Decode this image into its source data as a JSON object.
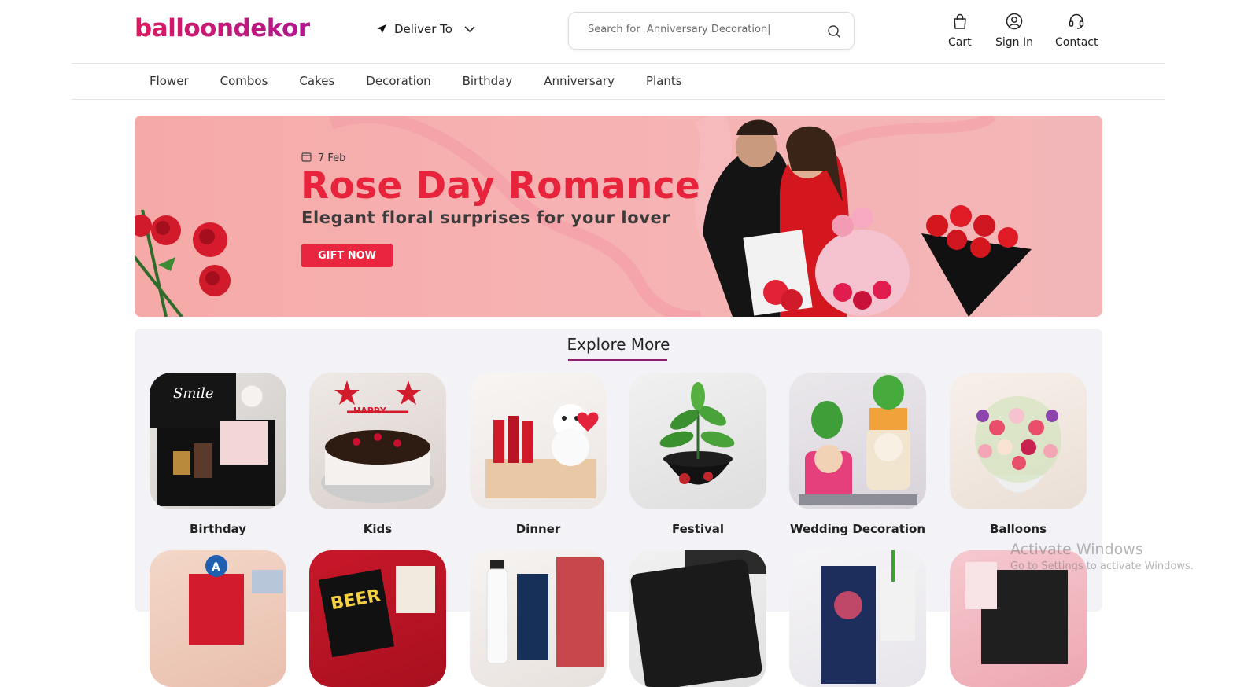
{
  "header": {
    "logo": "balloondekor",
    "deliver_label": "Deliver To",
    "search_placeholder": "Search for  Anniversary Decoration|",
    "cart_label": "Cart",
    "signin_label": "Sign In",
    "contact_label": "Contact"
  },
  "nav": {
    "items": [
      "Flower",
      "Combos",
      "Cakes",
      "Decoration",
      "Birthday",
      "Anniversary",
      "Plants"
    ]
  },
  "banner": {
    "date": "7 Feb",
    "title": "Rose Day Romance",
    "subtitle": "Elegant floral surprises for your lover",
    "cta": "GIFT NOW"
  },
  "explore": {
    "title": "Explore More",
    "categories": [
      "Birthday",
      "Kids",
      "Dinner",
      "Festival",
      "Wedding Decoration",
      "Balloons"
    ]
  },
  "watermark": {
    "line1": "Activate Windows",
    "line2": "Go to Settings to activate Windows."
  },
  "colors": {
    "brand": "#c2185b",
    "accent_red": "#ea2540",
    "banner_bg": "#f6b0b0",
    "explore_bg": "#f3f2f6",
    "underline": "#8e1f6b"
  }
}
